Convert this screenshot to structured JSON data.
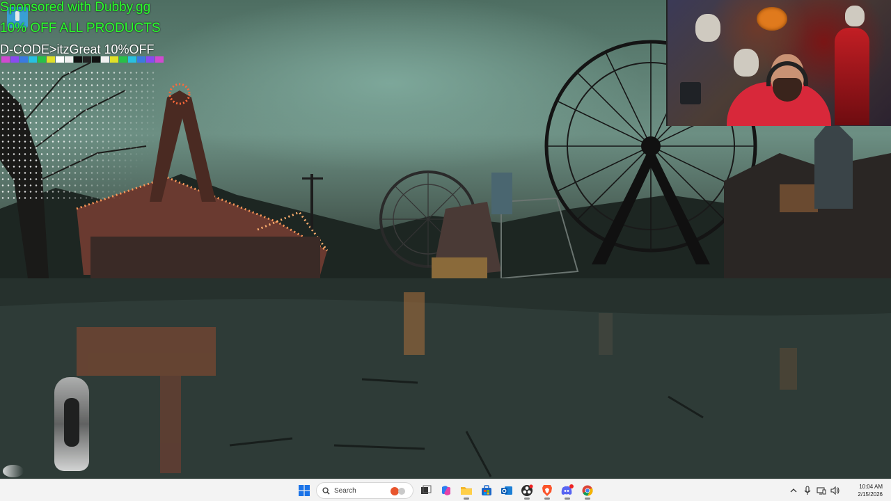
{
  "sponsor_overlay": {
    "line1": "Sponsored with Dubby.gg",
    "line2": "10% OFF ALL PRODUCTS",
    "line3": "D-CODE>itzGreat 10%OFF",
    "colors": {
      "text": "#2bff2b",
      "code_text": "#ffffff"
    },
    "color_swatches": [
      "#d04ad0",
      "#8a4af0",
      "#3a7ae0",
      "#28c0e0",
      "#28c048",
      "#e0e028",
      "#ffffff",
      "#f0f0f0",
      "#111111",
      "#222222",
      "#111111",
      "#f0f0f0",
      "#e0e028",
      "#28c048",
      "#28c0e0",
      "#3a7ae0",
      "#8a4af0",
      "#d04ad0"
    ]
  },
  "taskbar": {
    "search_placeholder": "Search",
    "clock_time": "10:04 AM",
    "clock_date": "2/15/2026",
    "background": "#f3f3f3",
    "apps": [
      {
        "name": "start-button",
        "icon": "windows-logo-icon"
      },
      {
        "name": "task-view-button",
        "icon": "task-view-icon"
      },
      {
        "name": "copilot-button",
        "icon": "copilot-icon"
      },
      {
        "name": "file-explorer-button",
        "icon": "folder-icon"
      },
      {
        "name": "microsoft-store-button",
        "icon": "store-icon"
      },
      {
        "name": "outlook-button",
        "icon": "outlook-icon"
      },
      {
        "name": "obs-button",
        "icon": "obs-icon"
      },
      {
        "name": "brave-button",
        "icon": "brave-icon"
      },
      {
        "name": "discord-button",
        "icon": "discord-icon"
      },
      {
        "name": "chrome-button",
        "icon": "chrome-icon"
      }
    ],
    "tray": [
      {
        "name": "show-hidden-icons",
        "icon": "chevron-up-icon",
        "glyph": "^"
      },
      {
        "name": "microphone-tray",
        "icon": "microphone-icon",
        "glyph": "🎙"
      },
      {
        "name": "network-tray",
        "icon": "network-icon",
        "glyph": "▭"
      },
      {
        "name": "volume-tray",
        "icon": "speaker-icon",
        "glyph": "🔊"
      }
    ]
  }
}
